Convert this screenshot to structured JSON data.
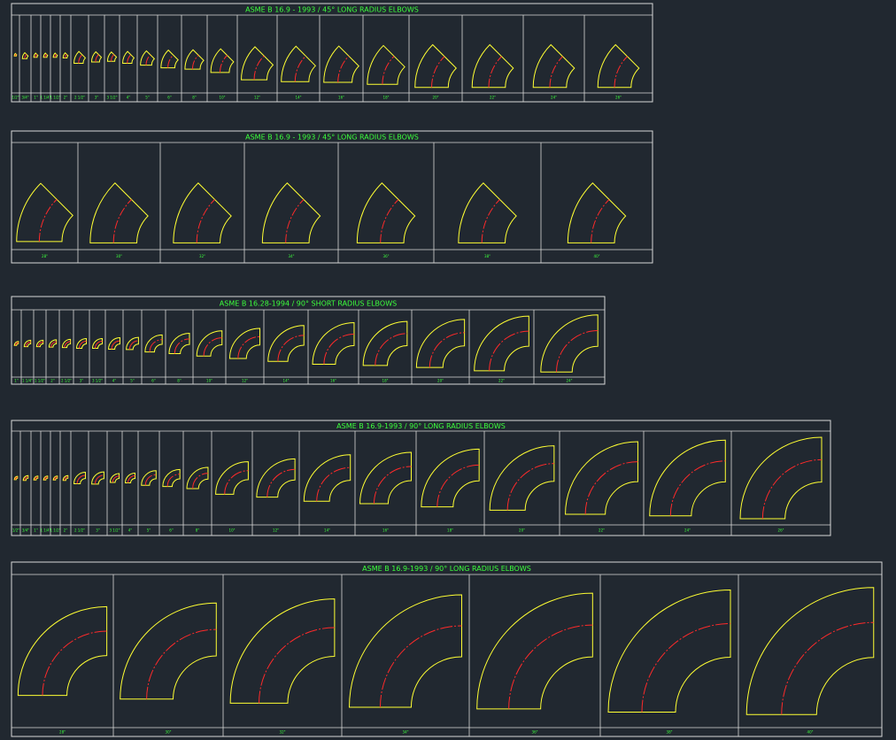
{
  "colors": {
    "background": "#212830",
    "frame": "#d8d8d8",
    "title_text": "#3cff3c",
    "elbow_outline": "#ffff33",
    "centerline": "#ff2a2a"
  },
  "tables": [
    {
      "id": "table-45lr-small",
      "title": "ASME B 16.9 - 1993 / 45° LONG RADIUS ELBOWS",
      "angle": 45,
      "sizes": [
        "1/2\"",
        "3/4\"",
        "1\"",
        "1 1/4\"",
        "1 1/2\"",
        "2\"",
        "2 1/2\"",
        "3\"",
        "3 1/2\"",
        "4\"",
        "5\"",
        "6\"",
        "8\"",
        "10\"",
        "12\"",
        "14\"",
        "16\"",
        "18\"",
        "20\"",
        "22\"",
        "24\"",
        "26\""
      ]
    },
    {
      "id": "table-45lr-large",
      "title": "ASME B 16.9 - 1993 / 45° LONG RADIUS ELBOWS",
      "angle": 45,
      "sizes": [
        "28\"",
        "30\"",
        "32\"",
        "34\"",
        "36\"",
        "38\"",
        "40\""
      ]
    },
    {
      "id": "table-90sr",
      "title": "ASME B 16.28-1994 / 90° SHORT RADIUS ELBOWS",
      "angle": 90,
      "sizes": [
        "1\"",
        "1 1/4\"",
        "1 1/2\"",
        "2\"",
        "2 1/2\"",
        "3\"",
        "3 1/2\"",
        "4\"",
        "5\"",
        "6\"",
        "8\"",
        "10\"",
        "12\"",
        "14\"",
        "16\"",
        "18\"",
        "20\"",
        "22\"",
        "24\""
      ]
    },
    {
      "id": "table-90lr-small",
      "title": "ASME B 16.9-1993 / 90° LONG RADIUS ELBOWS",
      "angle": 90,
      "sizes": [
        "1/2\"",
        "3/4\"",
        "1\"",
        "1 1/4\"",
        "1 1/2\"",
        "2\"",
        "2 1/2\"",
        "3\"",
        "3 1/2\"",
        "4\"",
        "5\"",
        "6\"",
        "8\"",
        "10\"",
        "12\"",
        "14\"",
        "16\"",
        "18\"",
        "20\"",
        "22\"",
        "24\"",
        "26\""
      ]
    },
    {
      "id": "table-90lr-large",
      "title": "ASME B 16.9-1993 / 90° LONG RADIUS ELBOWS",
      "angle": 90,
      "sizes": [
        "28\"",
        "30\"",
        "32\"",
        "34\"",
        "36\"",
        "38\"",
        "40\""
      ]
    }
  ]
}
